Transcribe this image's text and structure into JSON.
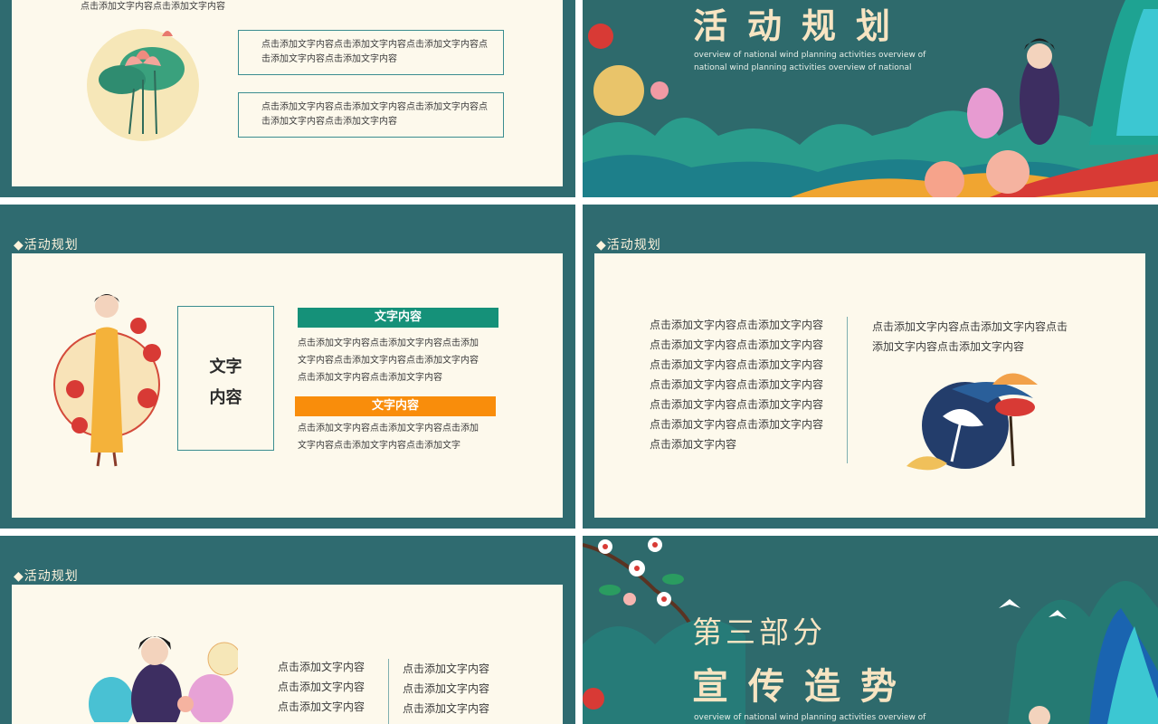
{
  "slide1": {
    "top_text": "点击添加文字内容点击添加文字内容",
    "box1_text": "点击添加文字内容点击添加文字内容点击添加文字内容点击添加文字内容点击添加文字内容",
    "box2_text": "点击添加文字内容点击添加文字内容点击添加文字内容点击添加文字内容点击添加文字内容"
  },
  "slide2": {
    "title": "活动规划",
    "subtitle": "overview of national wind planning activities overview of national wind planning activities overview of national"
  },
  "slide3": {
    "section": "◆活动规划",
    "box_title_line1": "文字",
    "box_title_line2": "内容",
    "banner1": "文字内容",
    "para1": [
      "点击添加文字内容点击添加文字内容点击添加",
      "文字内容点击添加文字内容点击添加文字内容",
      "点击添加文字内容点击添加文字内容"
    ],
    "banner2": "文字内容",
    "para2": [
      "点击添加文字内容点击添加文字内容点击添加",
      "文字内容点击添加文字内容点击添加文字"
    ]
  },
  "slide4": {
    "section": "◆活动规划",
    "left_lines": [
      "点击添加文字内容点击添加文字内容",
      "点击添加文字内容点击添加文字内容",
      "点击添加文字内容点击添加文字内容",
      "点击添加文字内容点击添加文字内容",
      "点击添加文字内容点击添加文字内容",
      "点击添加文字内容点击添加文字内容",
      "点击添加文字内容"
    ],
    "right_lines": [
      "点击添加文字内容点击添加文字内容点击",
      "添加文字内容点击添加文字内容"
    ]
  },
  "slide5": {
    "section": "◆活动规划",
    "left_lines": [
      "点击添加文字内容",
      "点击添加文字内容",
      "点击添加文字内容"
    ],
    "right_lines": [
      "点击添加文字内容",
      "点击添加文字内容",
      "点击添加文字内容"
    ]
  },
  "slide6": {
    "part": "第三部分",
    "title": "宣传造势",
    "subtitle": "overview of national wind planning activities overview of national"
  },
  "colors": {
    "teal_bg": "#2f6b70",
    "card": "#fdf9ec",
    "green_banner": "#159179",
    "orange_banner": "#f98d0b",
    "title_cream": "#f7e4c2"
  }
}
